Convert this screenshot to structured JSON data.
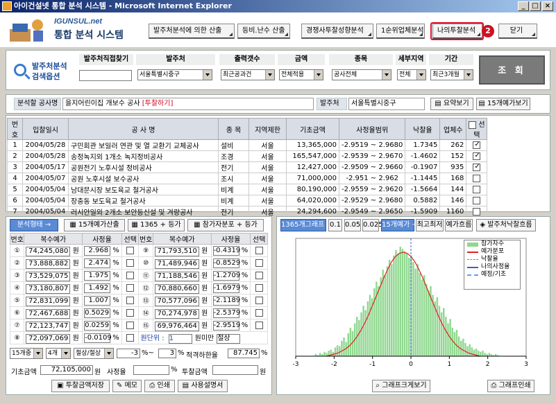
{
  "window": {
    "title": "아이건설넷 통합 분석 시스템 - Microsoft Internet Explorer"
  },
  "header": {
    "brand": "IGUNSUL.net",
    "title": "통합 분석 시스템",
    "buttons": [
      "발주처분석에 의한 산출",
      "등비.난수 산출",
      "경쟁사투찰성향분석",
      "1순위업체분석",
      "나의투찰분석",
      "닫기"
    ],
    "badge": "2"
  },
  "search": {
    "title_line1": "발주처분석",
    "title_line2": "검색옵션",
    "headers": [
      "발주처직접찾기",
      "발주처",
      "출력갯수",
      "금액",
      "종목",
      "세부지역",
      "기간"
    ],
    "direct_input": "",
    "selects": [
      "서울특별시중구",
      "최근공과건",
      "전체적용",
      "공사전체",
      "전체",
      "최근3개월"
    ],
    "submit": "조 회"
  },
  "info": {
    "project_label": "분석할 공사명",
    "project_name": "을지어린이집 개보수 공사",
    "project_link": "[투찰하기]",
    "agency_label": "발주처",
    "agency_value": "서울특별시중구",
    "btn_summary": "요약보기",
    "btn_price": "15개예가보기"
  },
  "list": {
    "headers": [
      "번호",
      "입찰일시",
      "공 사 명",
      "종 목",
      "지역제한",
      "기초금액",
      "사정율범위",
      "낙찰율",
      "업체수",
      "선택"
    ],
    "rows": [
      [
        "1",
        "2004/05/28",
        "구민회관 보일러 연관 및 열 교환기 교체공사",
        "설비",
        "서울",
        "13,365,000",
        "-2.9519 ~ 2.9680",
        "1.7345",
        "262",
        true
      ],
      [
        "2",
        "2004/05/28",
        "송정녹지외 1개소 녹지정비공사",
        "조경",
        "서울",
        "165,547,000",
        "-2.9539 ~ 2.9670",
        "-1.4602",
        "152",
        true
      ],
      [
        "3",
        "2004/05/17",
        "공원전기 노후시설 정비공사",
        "전기",
        "서울",
        "12,427,000",
        "-2.9509 ~ 2.9660",
        "-0.1907",
        "935",
        true
      ],
      [
        "4",
        "2004/05/07",
        "공원 노후시설 보수공사",
        "조시",
        "서울",
        "71,000,000",
        "-2.951 ~ 2.962",
        "-1.1445",
        "168",
        false
      ],
      [
        "5",
        "2004/05/04",
        "남대문시장 보도육교 철거공사",
        "비계",
        "서울",
        "80,190,000",
        "-2.9559 ~ 2.9620",
        "-1.5664",
        "144",
        false
      ],
      [
        "6",
        "2004/05/04",
        "장충동 보도육교 철거공사",
        "비계",
        "서울",
        "64,020,000",
        "-2.9529 ~ 2.9680",
        "0.5882",
        "146",
        false
      ],
      [
        "7",
        "2004/05/04",
        "러시안일외 2개소 보안등신설 및 겨량공사",
        "전기",
        "서울",
        "24,294,600",
        "-2.9549 ~ 2.9650",
        "-1.5909",
        "1160",
        false
      ]
    ]
  },
  "left": {
    "btn_analysis": "분석형태 →",
    "btn_15": "15개예가산출",
    "btn_1365": "1365 + 등가",
    "btn_dist": "참가자분포 + 등가",
    "headers": [
      "번호",
      "복수예가",
      "사정율",
      "선택",
      "번호",
      "복수예가",
      "사정율",
      "선택"
    ],
    "unit_won": "원",
    "unit_pct": "%",
    "left_rows": [
      [
        "①",
        "74,245,080",
        "2.968"
      ],
      [
        "②",
        "73,888,882",
        "2.474"
      ],
      [
        "③",
        "73,529,075",
        "1.975"
      ],
      [
        "④",
        "73,180,807",
        "1.492"
      ],
      [
        "⑤",
        "72,831,099",
        "1.007"
      ],
      [
        "⑥",
        "72,467,688",
        "0.5029"
      ],
      [
        "⑦",
        "72,123,747",
        "0.0259"
      ],
      [
        "⑧",
        "72,097,069",
        "-0.0109"
      ]
    ],
    "right_rows": [
      [
        "⑨",
        "71,793,510",
        "-0.4319"
      ],
      [
        "⑩",
        "71,489,946",
        "-0.8529"
      ],
      [
        "⑪",
        "71,188,546",
        "-1.2709"
      ],
      [
        "⑫",
        "70,880,660",
        "-1.6979"
      ],
      [
        "⑬",
        "70,577,096",
        "-2.1189"
      ],
      [
        "⑭",
        "70,274,978",
        "-2.5379"
      ],
      [
        "⑮",
        "69,976,464",
        "-2.9519"
      ]
    ],
    "unit_label": "원단위 :",
    "unit_select": "1",
    "unit_below": "원미만",
    "unit_mode": "절상",
    "opt1": "15개중",
    "opt2": "4개",
    "opt3": "절상/절상",
    "range_from": "-3",
    "range_sep": "%~",
    "range_to": "3",
    "adequate_label": "적격하한율",
    "adequate_value": "87.745",
    "base_label": "기초금액",
    "base_value": "72,105,000",
    "rate_label": "사정율",
    "rate_value": "",
    "bid_label": "투찰금액",
    "bid_value": "",
    "btn_save": "투찰금액저장",
    "btn_memo": "메모",
    "btn_print": "인쇄",
    "btn_manual": "사용설명서"
  },
  "right": {
    "btn_graph": "1365개그래프 →",
    "btn_01": "0.1",
    "btn_005": "0.05",
    "btn_0025": "0.025",
    "btn_15": "15개예가 →",
    "btn_max": "최고최저",
    "btn_flow": "예가흐름",
    "btn_success": "발주처낙찰흐름",
    "btn_bigger": "그래프크게보기",
    "btn_print": "그래프인쇄"
  },
  "chart_data": {
    "type": "bar",
    "xlim": [
      -3,
      3
    ],
    "xticks": [
      "-3",
      "-2",
      "-1",
      "0",
      "1",
      "2",
      "3"
    ],
    "series": [
      {
        "name": "참가자수",
        "color": "#90d890"
      },
      {
        "name": "예가분포",
        "color": "#e02020"
      },
      {
        "name": "낙찰율",
        "color": "#d06060"
      },
      {
        "name": "나의사정율",
        "color": "#4060c0"
      },
      {
        "name": "예정/기초",
        "color": "#60a0e0"
      }
    ],
    "bars": [
      2,
      1,
      3,
      2,
      4,
      3,
      5,
      6,
      4,
      8,
      10,
      9,
      14,
      17,
      13,
      21,
      26,
      23,
      30,
      36,
      33,
      40,
      46,
      42,
      50,
      56,
      53,
      62,
      68,
      64,
      72,
      79,
      74,
      82,
      88,
      84,
      92,
      97,
      94,
      100,
      98,
      96,
      94,
      90,
      92,
      86,
      80,
      84,
      76,
      70,
      74,
      66,
      60,
      64,
      56,
      50,
      54,
      46,
      40,
      44,
      36,
      30,
      34,
      26,
      22,
      24,
      18,
      14,
      16,
      12,
      9,
      11,
      8,
      6,
      7,
      5,
      4,
      5,
      3,
      2,
      3,
      2,
      1,
      2,
      1
    ],
    "curve": [
      0,
      1,
      2,
      3,
      5,
      7,
      10,
      14,
      19,
      25,
      32,
      40,
      49,
      58,
      67,
      76,
      84,
      91,
      96,
      99,
      100,
      99,
      96,
      91,
      84,
      76,
      67,
      58,
      49,
      40,
      32,
      25,
      19,
      14,
      10,
      7,
      5,
      3,
      2,
      1,
      0
    ]
  }
}
